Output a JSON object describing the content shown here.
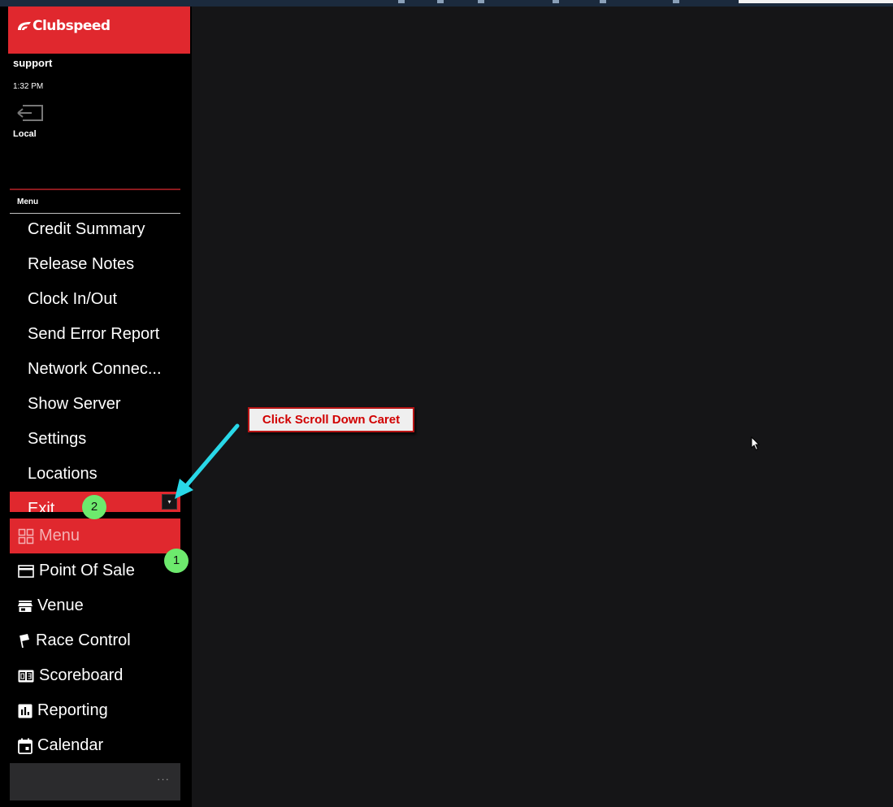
{
  "brand": {
    "name": "Clubspeed",
    "color": "#e0282e"
  },
  "session": {
    "user": "support",
    "time": "1:32 PM",
    "location": "Local",
    "logout_icon": "logout-icon"
  },
  "menu": {
    "header": "Menu",
    "items": [
      {
        "label": "Credit Summary"
      },
      {
        "label": "Release Notes"
      },
      {
        "label": "Clock In/Out"
      },
      {
        "label": "Send Error Report"
      },
      {
        "label": "Network Connec..."
      },
      {
        "label": "Show Server"
      },
      {
        "label": "Settings"
      },
      {
        "label": "Locations"
      },
      {
        "label": "Exit"
      }
    ],
    "scroll_caret": "▾"
  },
  "nav": {
    "items": [
      {
        "label": "Menu",
        "icon": "grid-icon",
        "active": true
      },
      {
        "label": "Point Of Sale",
        "icon": "credit-card-icon"
      },
      {
        "label": "Venue",
        "icon": "store-icon"
      },
      {
        "label": "Race Control",
        "icon": "flag-icon"
      },
      {
        "label": "Scoreboard",
        "icon": "scoreboard-icon"
      },
      {
        "label": "Reporting",
        "icon": "bar-chart-icon"
      },
      {
        "label": "Calendar",
        "icon": "calendar-icon"
      }
    ],
    "more": "···"
  },
  "annotation": {
    "callout": "Click Scroll Down Caret",
    "step1": "1",
    "step2": "2",
    "arrow_color": "#29d8e8",
    "badge_color": "#6dea6d"
  }
}
